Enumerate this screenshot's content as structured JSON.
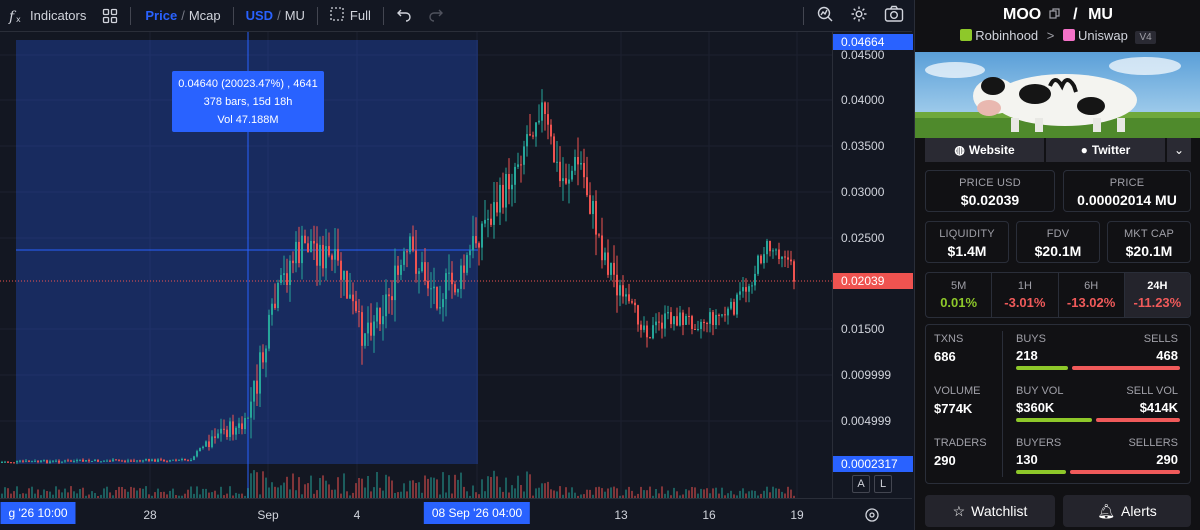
{
  "toolbar": {
    "indicators_label": "Indicators",
    "price_label": "Price",
    "slash": "/",
    "mcap_label": "Mcap",
    "usd_label": "USD",
    "mu_label": "MU",
    "full_label": "Full"
  },
  "chart_data": {
    "type": "candlestick",
    "price_ticks": [
      "0.04500",
      "0.04000",
      "0.03500",
      "0.03000",
      "0.02500",
      "0.01500",
      "0.009999",
      "0.004999"
    ],
    "time_ticks": [
      "28",
      "Sep",
      "4",
      "13",
      "16",
      "19"
    ],
    "crosshair_price": "0.04664",
    "crosshair_price_low": "0.0002317",
    "current_price_tag": "0.02039",
    "time_tag_left": "g '26   10:00",
    "time_tag_right": "08 Sep '26   04:00",
    "measure_tooltip": {
      "line1": "0.04640 (20023.47%) , 4641",
      "line2": "378 bars, 15d 18h",
      "line3": "Vol 47.188M"
    },
    "auto_label": "A",
    "log_label": "L",
    "colors": {
      "up": "#26a69a",
      "down": "#ef5350",
      "selection": "#2962ff"
    }
  },
  "panel": {
    "token": "MOO",
    "separator": "/",
    "quote": "MU",
    "chain": "Robinhood",
    "dex": "Uniswap",
    "version": "V4",
    "website_label": "Website",
    "twitter_label": "Twitter",
    "price_usd_label": "PRICE USD",
    "price_usd": "$0.02039",
    "price_label": "PRICE",
    "price_native": "0.00002014 MU",
    "liquidity_label": "LIQUIDITY",
    "liquidity": "$1.4M",
    "fdv_label": "FDV",
    "fdv": "$20.1M",
    "mcap_label": "MKT CAP",
    "mcap": "$20.1M",
    "timeframes": [
      {
        "label": "5M",
        "value": "0.01%",
        "color": "#8ec82a"
      },
      {
        "label": "1H",
        "value": "-3.01%",
        "color": "#f05a5a"
      },
      {
        "label": "6H",
        "value": "-13.02%",
        "color": "#f05a5a"
      },
      {
        "label": "24H",
        "value": "-11.23%",
        "color": "#f05a5a"
      }
    ],
    "txns_label": "TXNS",
    "txns": "686",
    "buys_label": "BUYS",
    "buys": "218",
    "sells_label": "SELLS",
    "sells": "468",
    "volume_label": "VOLUME",
    "volume": "$774K",
    "buy_vol_label": "BUY VOL",
    "buy_vol": "$360K",
    "sell_vol_label": "SELL VOL",
    "sell_vol": "$414K",
    "traders_label": "TRADERS",
    "traders": "290",
    "buyers_label": "BUYERS",
    "buyers": "130",
    "sellers_label": "SELLERS",
    "sellers": "290",
    "watchlist_label": "Watchlist",
    "alerts_label": "Alerts"
  }
}
